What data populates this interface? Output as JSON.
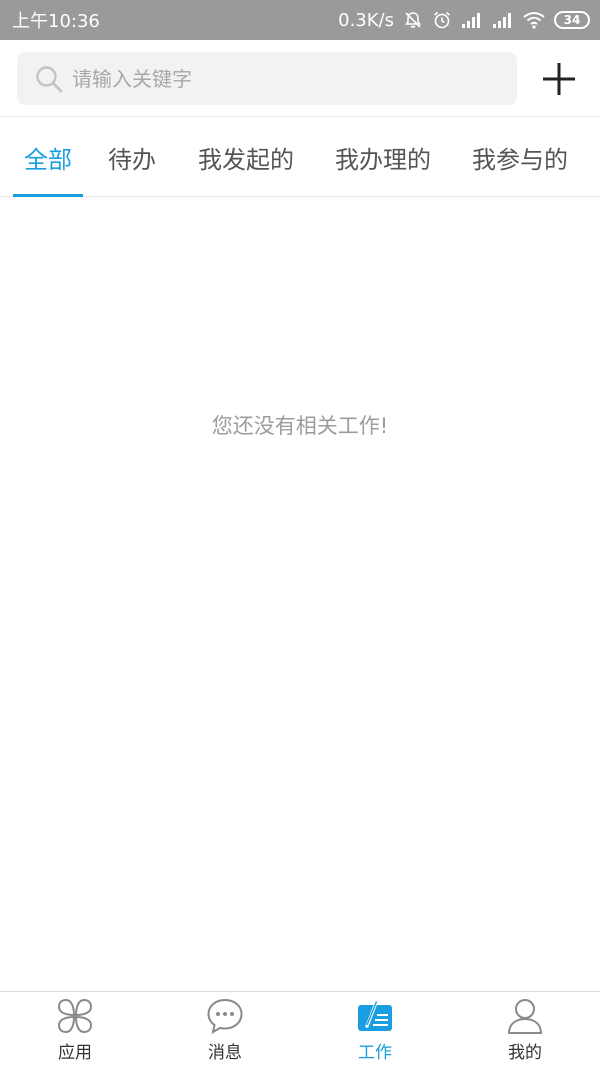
{
  "status_bar": {
    "time": "上午10:36",
    "network_speed": "0.3K/s",
    "battery": "34"
  },
  "search": {
    "placeholder": "请输入关键字",
    "value": ""
  },
  "tabs": [
    {
      "label": "全部",
      "active": true
    },
    {
      "label": "待办",
      "active": false
    },
    {
      "label": "我发起的",
      "active": false
    },
    {
      "label": "我办理的",
      "active": false
    },
    {
      "label": "我参与的",
      "active": false
    }
  ],
  "empty_message": "您还没有相关工作!",
  "bottom_nav": [
    {
      "label": "应用",
      "icon": "apps-icon",
      "active": false
    },
    {
      "label": "消息",
      "icon": "message-icon",
      "active": false
    },
    {
      "label": "工作",
      "icon": "work-icon",
      "active": true
    },
    {
      "label": "我的",
      "icon": "profile-icon",
      "active": false
    }
  ],
  "colors": {
    "accent": "#1a9ee2",
    "status_bar_bg": "#9a9a9a",
    "search_bg": "#f2f2f2",
    "empty_text": "#9c9c9c"
  }
}
